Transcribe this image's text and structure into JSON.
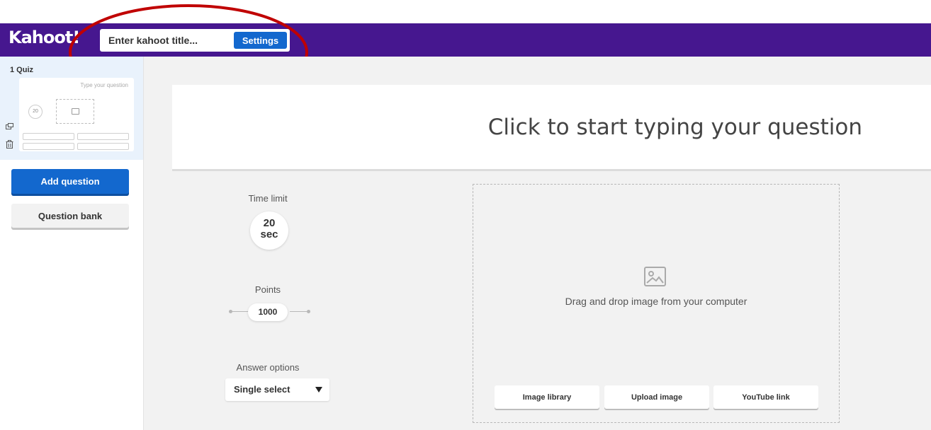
{
  "header": {
    "logo": "Kahoot!",
    "title_placeholder": "Enter kahoot title...",
    "settings_label": "Settings"
  },
  "sidebar": {
    "slide": {
      "label": "1  Quiz",
      "thumb_question": "Type your question",
      "thumb_time": "20"
    },
    "add_question_label": "Add question",
    "question_bank_label": "Question bank"
  },
  "editor": {
    "question_placeholder": "Click to start typing your question",
    "time_limit": {
      "label": "Time limit",
      "value": "20",
      "unit": "sec"
    },
    "points": {
      "label": "Points",
      "value": "1000"
    },
    "answer_options": {
      "label": "Answer options",
      "value": "Single select"
    },
    "media": {
      "prompt": "Drag and drop image from your computer",
      "buttons": [
        "Image library",
        "Upload image",
        "YouTube link"
      ]
    }
  },
  "colors": {
    "header": "#46178f",
    "primary_button": "#1368ce",
    "annotation": "#c00000"
  },
  "icons": [
    "image-icon",
    "duplicate-icon",
    "trash-icon",
    "caret-down-icon"
  ]
}
